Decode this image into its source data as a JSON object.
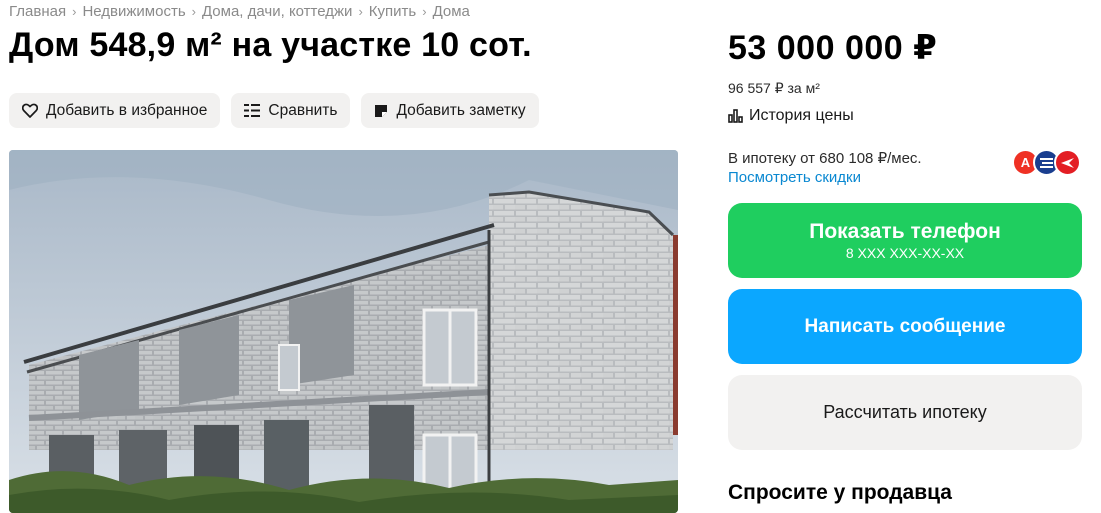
{
  "breadcrumbs": [
    "Главная",
    "Недвижимость",
    "Дома, дачи, коттеджи",
    "Купить",
    "Дома"
  ],
  "title": "Дом 548,9 м² на участке 10 сот.",
  "actions": {
    "favorite": "Добавить в избранное",
    "compare": "Сравнить",
    "note": "Добавить заметку"
  },
  "price": {
    "total": "53 000 000 ₽",
    "per_m2": "96 557 ₽ за м²",
    "history": "История цены"
  },
  "mortgage": {
    "text": "В ипотеку от 680 108 ₽/мес.",
    "discounts_link": "Посмотреть скидки",
    "bank_logos": [
      {
        "icon": "alfa-bank-logo",
        "color": "#ef3124",
        "letter": "А"
      },
      {
        "icon": "bank-logo-blue",
        "color": "#1a3e8f"
      },
      {
        "icon": "bank-logo-red",
        "color": "#e31e24"
      }
    ]
  },
  "buttons": {
    "show_phone": "Показать телефон",
    "phone_mask": "8 XXX XXX-XX-XX",
    "write_message": "Написать сообщение",
    "calc_mortgage": "Рассчитать ипотеку"
  },
  "ask_seller": "Спросите у продавца",
  "colors": {
    "phone_button": "#1fce5f",
    "message_button": "#0ba7ff",
    "link": "#0a88d1"
  }
}
